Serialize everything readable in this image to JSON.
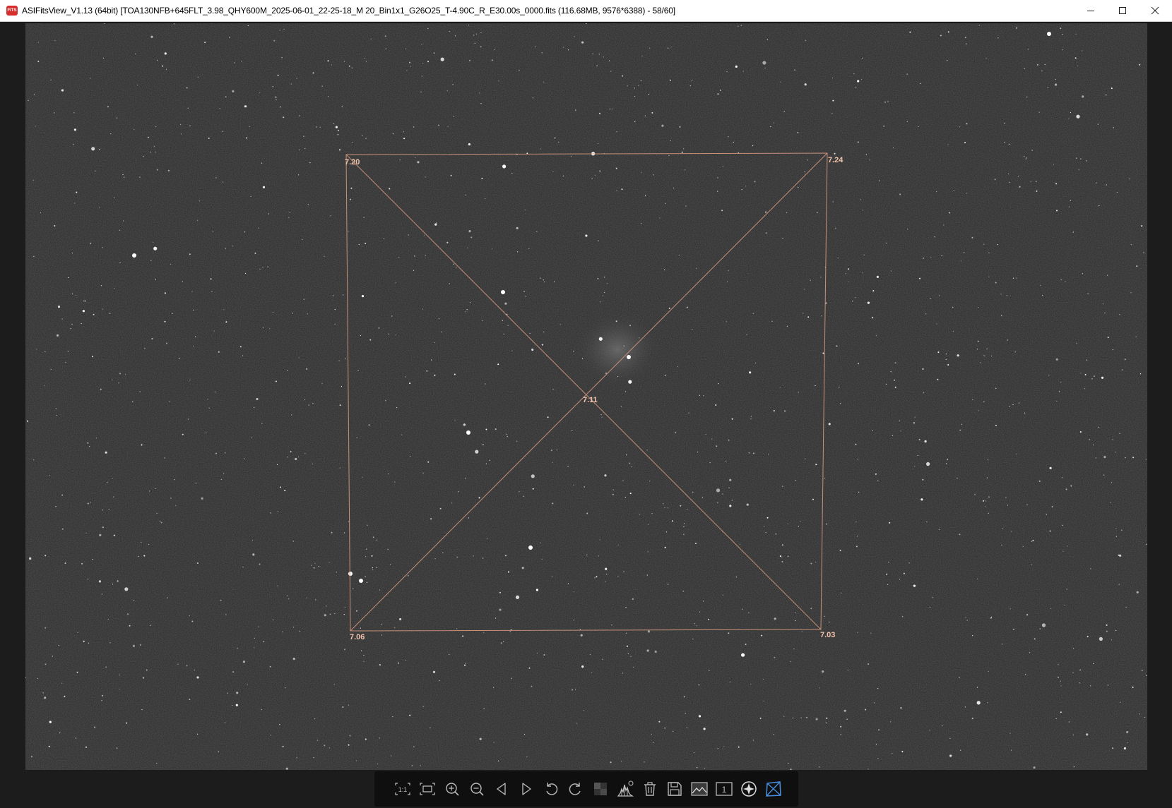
{
  "window": {
    "title": "ASIFitsView_V1.13 (64bit) [TOA130NFB+645FLT_3.98_QHY600M_2025-06-01_22-25-18_M 20_Bin1x1_G26O25_T-4.90C_R_E30.00s_0000.fits (116.68MB, 9576*6388) - 58/60]",
    "app_icon_text": "FITS",
    "minimize_icon": "minimize-icon",
    "maximize_icon": "maximize-icon",
    "close_icon": "close-icon"
  },
  "tilt_analysis": {
    "corner_top_left": "7.20",
    "corner_top_right": "7.24",
    "corner_bottom_left": "7.06",
    "corner_bottom_right": "7.03",
    "center": "7.11",
    "overlay_color": "#c8917a",
    "label_color": "#f2c4ae"
  },
  "toolbar": {
    "buttons": [
      {
        "name": "actual-size-icon",
        "label": "1:1"
      },
      {
        "name": "fit-window-icon"
      },
      {
        "name": "zoom-in-icon"
      },
      {
        "name": "zoom-out-icon"
      },
      {
        "name": "previous-icon"
      },
      {
        "name": "next-icon"
      },
      {
        "name": "rotate-left-icon"
      },
      {
        "name": "rotate-right-icon"
      },
      {
        "name": "stretch-icon"
      },
      {
        "name": "histogram-icon"
      },
      {
        "name": "delete-icon"
      },
      {
        "name": "save-icon"
      },
      {
        "name": "image-info-icon"
      },
      {
        "name": "single-frame-icon",
        "label": "1"
      },
      {
        "name": "star-analysis-icon"
      },
      {
        "name": "tilt-analysis-icon",
        "active_color": "#4a90e2"
      }
    ]
  }
}
